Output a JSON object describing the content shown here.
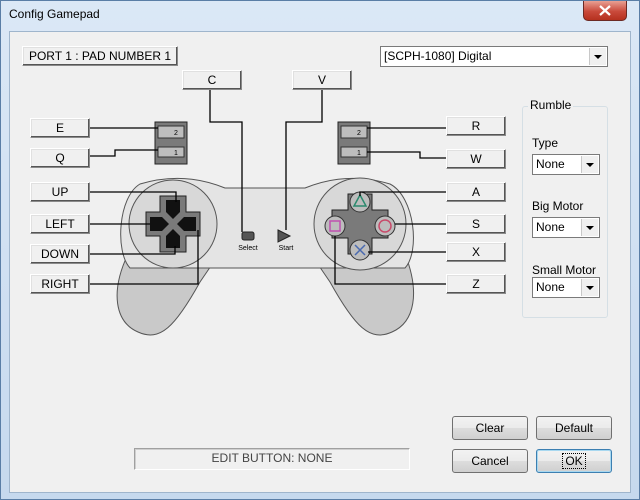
{
  "window": {
    "title": "Config Gamepad"
  },
  "port_label": "PORT 1 : PAD NUMBER 1",
  "pad_type": {
    "selected": "[SCPH-1080] Digital"
  },
  "bindings": {
    "select": "C",
    "start": "V",
    "l2": "E",
    "l1": "Q",
    "up": "UP",
    "left": "LEFT",
    "down": "DOWN",
    "right": "RIGHT",
    "r2": "R",
    "r1": "W",
    "triangle": "A",
    "circle": "S",
    "cross": "X",
    "square": "Z"
  },
  "controller_labels": {
    "select": "Select",
    "start": "Start",
    "l2": "2",
    "l1": "1",
    "r2": "2",
    "r1": "1"
  },
  "rumble": {
    "title": "Rumble",
    "type_label": "Type",
    "type_value": "None",
    "big_label": "Big Motor",
    "big_value": "None",
    "small_label": "Small Motor",
    "small_value": "None"
  },
  "buttons": {
    "clear": "Clear",
    "default": "Default",
    "cancel": "Cancel",
    "ok": "OK"
  },
  "status": "EDIT BUTTON: NONE",
  "colors": {
    "title_bg": "#cfe1f3",
    "close_red": "#c94a3b",
    "dialog_bg": "#f0f0f0",
    "pad_body": "#e0e0e0",
    "pad_dark": "#5a5a5a"
  }
}
